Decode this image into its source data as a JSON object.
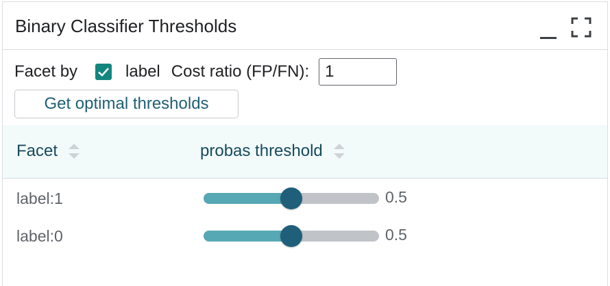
{
  "panel": {
    "title": "Binary Classifier Thresholds"
  },
  "controls": {
    "facet_by_label": "Facet by",
    "facet_checkbox_checked": true,
    "facet_checkbox_label": "label",
    "cost_ratio_label": "Cost ratio (FP/FN):",
    "cost_ratio_value": "1",
    "optimal_button_label": "Get optimal thresholds"
  },
  "table": {
    "columns": [
      "Facet",
      "probas threshold"
    ],
    "rows": [
      {
        "facet": "label:1",
        "threshold": 0.5,
        "threshold_text": "0.5"
      },
      {
        "facet": "label:0",
        "threshold": 0.5,
        "threshold_text": "0.5"
      }
    ]
  },
  "colors": {
    "accent": "#12857f",
    "slider_fill": "#56a8b4",
    "slider_thumb": "#1f5f7a",
    "slider_track": "#c0c3c8",
    "header_bg": "#f2fbfa",
    "link_text": "#1f5f75"
  },
  "icons": {
    "minimize": "minimize-icon",
    "expand": "fullscreen-icon",
    "check": "check-icon",
    "sort": "sort-icon"
  }
}
